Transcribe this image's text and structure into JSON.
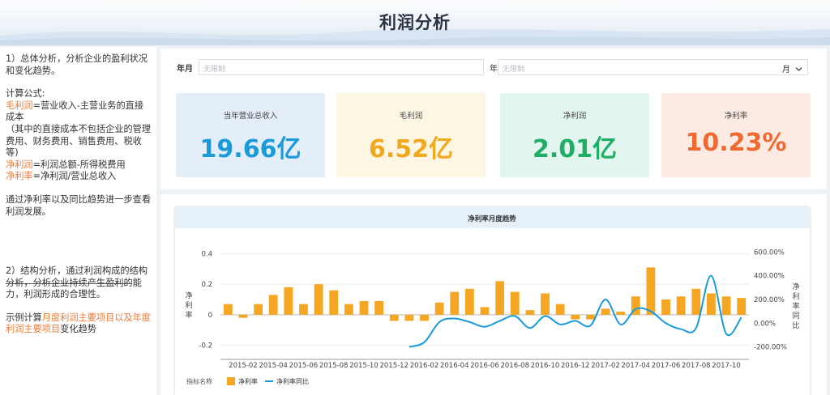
{
  "header": {
    "title": "利润分析"
  },
  "left_panel": {
    "section1_intro": "1）总体分析，分析企业的盈利状况和变化趋势。",
    "formula_title": "计算公式:",
    "gross_profit_term": "毛利润",
    "gross_profit_formula": "=营业收入-主营业务的直接成本",
    "gross_profit_note": "（其中的直接成本不包括企业的管理费用、财务费用、销售费用、税收等)",
    "net_profit_term": "净利润",
    "net_profit_formula": "=利润总额-所得税费用",
    "net_margin_term": "净利率",
    "net_margin_formula": "=净利润/营业总收入",
    "trend_note": "通过净利率以及同比趋势进一步查看利润发展。",
    "section2_intro": "2）结构分析，通过利润构成的结构分析，分析企业持续产生盈利的能力，利润形成的合理性。",
    "example_prefix": "示例计算",
    "example_highlight": "月度利润主要项目以及年度利润主要项目",
    "example_suffix": "变化趋势"
  },
  "filters": {
    "year_month_label": "年月",
    "year_month_placeholder": "无限制",
    "year_label": "年",
    "year_placeholder": "无限制",
    "month_label": "月",
    "month_chevron_icon": "chevron-down-icon"
  },
  "kpis": [
    {
      "label": "当年营业总收入",
      "value": "19.66亿",
      "color": "#1a9bd8",
      "bg": "#e3eef9"
    },
    {
      "label": "毛利润",
      "value": "6.52亿",
      "color": "#f0a81e",
      "bg": "#fdf6e3"
    },
    {
      "label": "净利润",
      "value": "2.01亿",
      "color": "#1fae66",
      "bg": "#e2f5ee"
    },
    {
      "label": "净利率",
      "value": "10.23%",
      "color": "#ee6a30",
      "bg": "#fdeae3"
    }
  ],
  "chart_data": {
    "type": "bar",
    "title": "净利率月度趋势",
    "ylabel": "净利率",
    "y2label": "净利率同比",
    "ylim": [
      -0.25,
      0.45
    ],
    "y2lim": [
      -250,
      650
    ],
    "yticks": [
      "0.4",
      "0.2",
      "0",
      "-0.2"
    ],
    "y2ticks": [
      "600.00%",
      "400.00%",
      "200.00%",
      "0.00%",
      "-200.00%"
    ],
    "xtick_labels": [
      "2015-02",
      "2015-04",
      "2015-06",
      "2015-08",
      "2015-10",
      "2015-12",
      "2016-02",
      "2016-04",
      "2016-06",
      "2016-08",
      "2016-10",
      "2016-12",
      "2017-02",
      "2017-04",
      "2017-06",
      "2017-08",
      "2017-10"
    ],
    "legend_title": "指标名称",
    "legend_position": "bottom-left",
    "categories": [
      "2015-01",
      "2015-02",
      "2015-03",
      "2015-04",
      "2015-05",
      "2015-06",
      "2015-07",
      "2015-08",
      "2015-09",
      "2015-10",
      "2015-11",
      "2015-12",
      "2016-01",
      "2016-02",
      "2016-03",
      "2016-04",
      "2016-05",
      "2016-06",
      "2016-07",
      "2016-08",
      "2016-09",
      "2016-10",
      "2016-11",
      "2016-12",
      "2017-01",
      "2017-02",
      "2017-03",
      "2017-04",
      "2017-05",
      "2017-06",
      "2017-07",
      "2017-08",
      "2017-09",
      "2017-10",
      "2017-11"
    ],
    "series": [
      {
        "name": "净利率",
        "kind": "bar",
        "color": "#f5a623",
        "values": [
          0.07,
          -0.02,
          0.07,
          0.13,
          0.18,
          0.07,
          0.2,
          0.16,
          0.07,
          0.09,
          0.09,
          -0.04,
          -0.04,
          -0.04,
          0.08,
          0.15,
          0.17,
          0.05,
          0.22,
          0.15,
          0.03,
          0.14,
          0.07,
          -0.03,
          -0.03,
          0.04,
          0.02,
          0.12,
          0.31,
          0.1,
          0.12,
          0.17,
          0.14,
          0.12,
          0.11
        ]
      },
      {
        "name": "净利率同比",
        "kind": "line",
        "color": "#1a9bd8",
        "values": [
          null,
          null,
          null,
          null,
          null,
          null,
          null,
          null,
          null,
          null,
          null,
          null,
          -200,
          -160,
          10,
          40,
          10,
          -30,
          20,
          60,
          -40,
          60,
          -10,
          20,
          -20,
          200,
          -10,
          120,
          100,
          0,
          -50,
          -40,
          400,
          -90,
          50
        ]
      }
    ]
  }
}
